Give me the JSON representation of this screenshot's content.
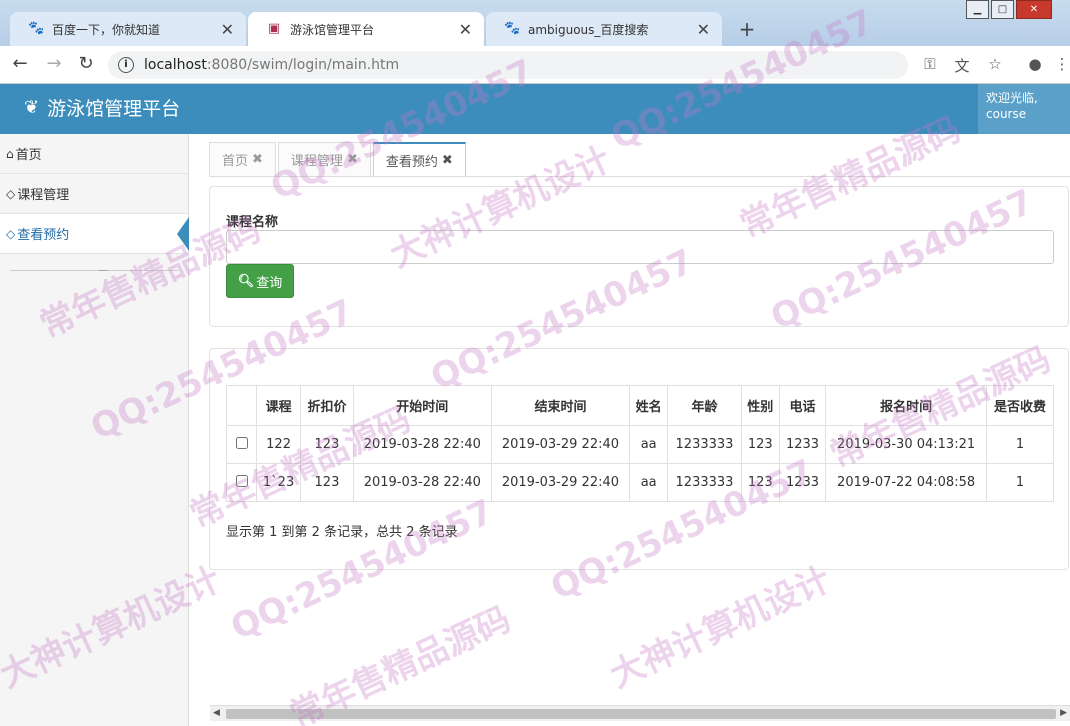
{
  "browser": {
    "tabs": [
      {
        "title": "百度一下，你就知道",
        "icon": "baidu-paw-icon"
      },
      {
        "title": "游泳馆管理平台",
        "icon": "site-favicon"
      },
      {
        "title": "ambiguous_百度搜索",
        "icon": "baidu-paw-icon"
      }
    ],
    "url_host": "localhost",
    "url_rest": ":8080/swim/login/main.htm"
  },
  "header": {
    "app_title": "游泳馆管理平台",
    "welcome_line1": "欢迎光临,",
    "welcome_user": "course",
    "color": "#3c8dbc"
  },
  "sidebar": {
    "items": [
      {
        "label": "首页",
        "icon": "home-icon"
      },
      {
        "label": "课程管理",
        "icon": "diamond-icon"
      },
      {
        "label": "查看预约",
        "icon": "diamond-icon"
      }
    ],
    "active_index": 2
  },
  "page_tabs": [
    {
      "label": "首页"
    },
    {
      "label": "课程管理"
    },
    {
      "label": "查看预约"
    }
  ],
  "search": {
    "label": "课程名称",
    "value": "",
    "button": "查询"
  },
  "table": {
    "headers": [
      "课程",
      "折扣价",
      "开始时间",
      "结束时间",
      "姓名",
      "年龄",
      "性别",
      "电话",
      "报名时间",
      "是否收费"
    ],
    "rows": [
      [
        "122",
        "123",
        "2019-03-28 22:40",
        "2019-03-29 22:40",
        "aa",
        "1233333",
        "123",
        "1233",
        "2019-03-30 04:13:21",
        "1"
      ],
      [
        "1`23",
        "123",
        "2019-03-28 22:40",
        "2019-03-29 22:40",
        "aa",
        "1233333",
        "123",
        "1233",
        "2019-07-22 04:08:58",
        "1"
      ]
    ],
    "summary": "显示第 1 到第 2 条记录，总共 2 条记录"
  },
  "watermarks": [
    {
      "text": "QQ:254540457"
    },
    {
      "text": "常年售精品源码"
    },
    {
      "text": "大神计算机设计"
    }
  ]
}
